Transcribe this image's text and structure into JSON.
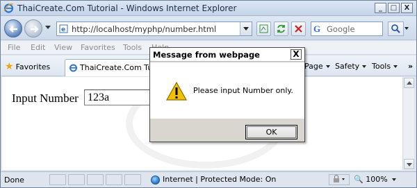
{
  "window": {
    "title": "ThaiCreate.Com Tutorial - Windows Internet Explorer",
    "minimize": "_",
    "maximize": "□",
    "close": "X"
  },
  "address": {
    "url": "http://localhost/myphp/number.html"
  },
  "search": {
    "placeholder": "Google"
  },
  "menu": {
    "items": [
      "File",
      "Edit",
      "View",
      "Favorites",
      "Tools",
      "Help"
    ]
  },
  "favorites": {
    "label": "Favorites"
  },
  "tab": {
    "label": "ThaiCreate.Com Tutorial"
  },
  "commands": {
    "page": "Page",
    "safety": "Safety",
    "tools": "Tools"
  },
  "page": {
    "input_label": "Input Number",
    "input_value": "123a"
  },
  "dialog": {
    "title": "Message from webpage",
    "message": "Please input Number only.",
    "ok_label": "OK",
    "close_label": "X"
  },
  "status": {
    "text": "Done",
    "zone": "Internet | Protected Mode: On",
    "zoom": "100%"
  },
  "colors": {
    "titlebar": "#c4d4ea",
    "warning": "#f2c200"
  }
}
